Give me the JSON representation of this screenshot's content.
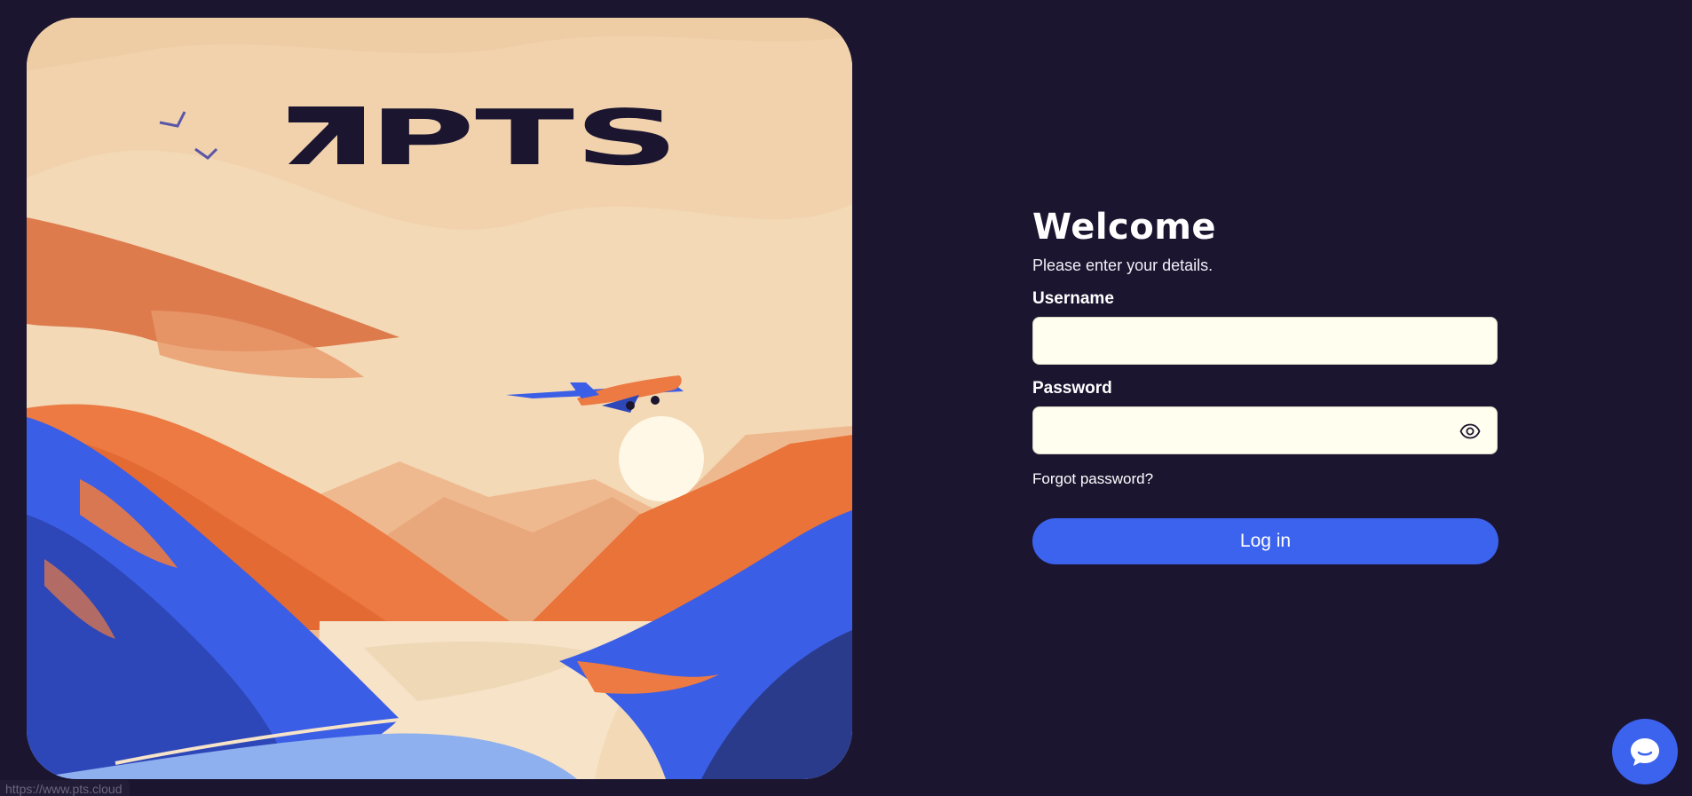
{
  "brand": {
    "logo_text": "PTS"
  },
  "login": {
    "title": "Welcome",
    "subtitle": "Please enter your details.",
    "username_label": "Username",
    "username_value": "",
    "password_label": "Password",
    "password_value": "",
    "forgot_label": "Forgot password?",
    "submit_label": "Log in"
  },
  "status_bar": {
    "url": "https://www.pts.cloud"
  },
  "icons": {
    "password_toggle": "eye-icon",
    "chat_widget": "chat-bubble-icon"
  },
  "colors": {
    "background": "#1b1530",
    "accent": "#3c63ee",
    "input_bg": "#fffeef",
    "illustration_orange": "#ec7a42",
    "illustration_blue": "#3b5ee6"
  }
}
